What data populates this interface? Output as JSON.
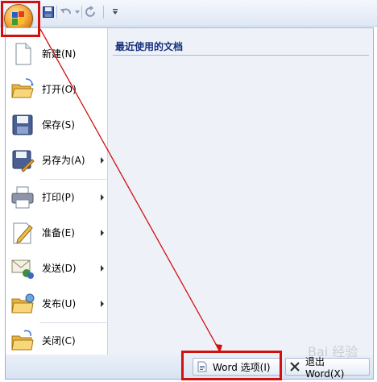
{
  "menu": {
    "items": [
      {
        "label": "新建(N)",
        "icon": "new-document-icon",
        "has_submenu": false
      },
      {
        "label": "打开(O)",
        "icon": "open-folder-icon",
        "has_submenu": false
      },
      {
        "label": "保存(S)",
        "icon": "save-floppy-icon",
        "has_submenu": false
      },
      {
        "label": "另存为(A)",
        "icon": "save-as-icon",
        "has_submenu": true
      },
      {
        "label": "打印(P)",
        "icon": "printer-icon",
        "has_submenu": true
      },
      {
        "label": "准备(E)",
        "icon": "prepare-pencil-icon",
        "has_submenu": true
      },
      {
        "label": "发送(D)",
        "icon": "send-mail-icon",
        "has_submenu": true
      },
      {
        "label": "发布(U)",
        "icon": "publish-folder-icon",
        "has_submenu": true
      },
      {
        "label": "关闭(C)",
        "icon": "close-folder-icon",
        "has_submenu": false
      }
    ]
  },
  "recent": {
    "title": "最近使用的文档"
  },
  "bottom": {
    "options_label": "Word 选项(I)",
    "exit_label": "退出 Word(X)"
  },
  "annotation": {
    "color": "#d21010"
  },
  "watermark": {
    "text": "Bai 经验"
  }
}
